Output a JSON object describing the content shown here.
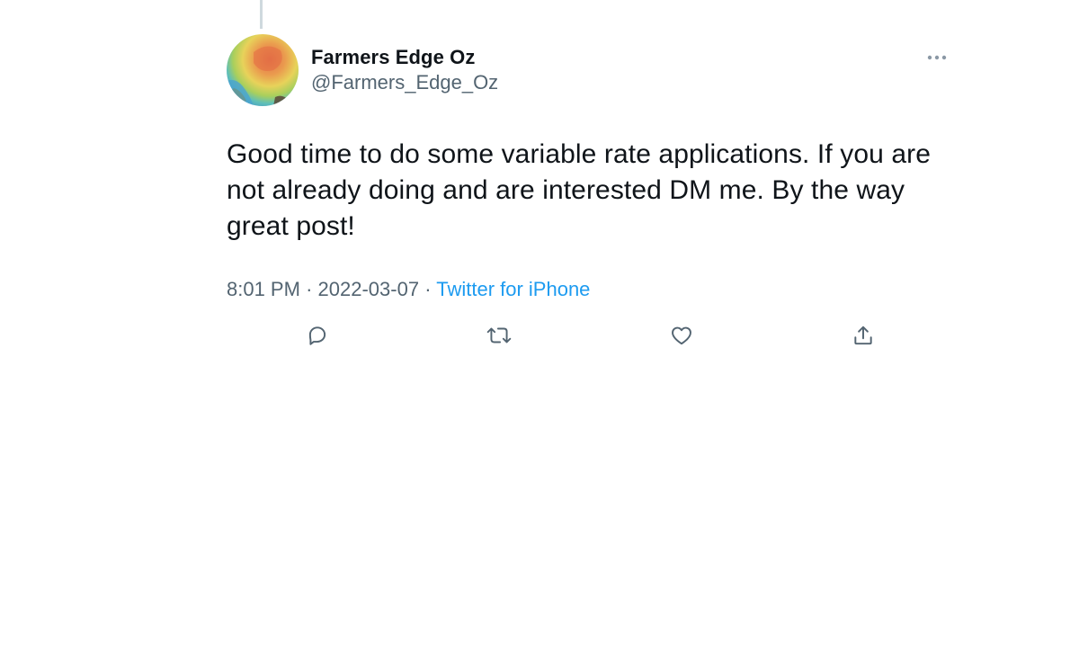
{
  "tweet": {
    "display_name": "Farmers Edge Oz",
    "handle": "@Farmers_Edge_Oz",
    "text": "Good time to do some variable rate applications. If you are not already doing and are interested DM me. By the way great post!",
    "time": "8:01 PM",
    "separator": "·",
    "date": "2022-03-07",
    "source": "Twitter for iPhone"
  },
  "icons": {
    "more": "more-horizontal-icon",
    "reply": "reply-icon",
    "retweet": "retweet-icon",
    "like": "heart-icon",
    "share": "share-icon"
  },
  "colors": {
    "text": "#0f1419",
    "secondary": "#536471",
    "link": "#1d9bf0",
    "thread_line": "#cfd9de"
  }
}
